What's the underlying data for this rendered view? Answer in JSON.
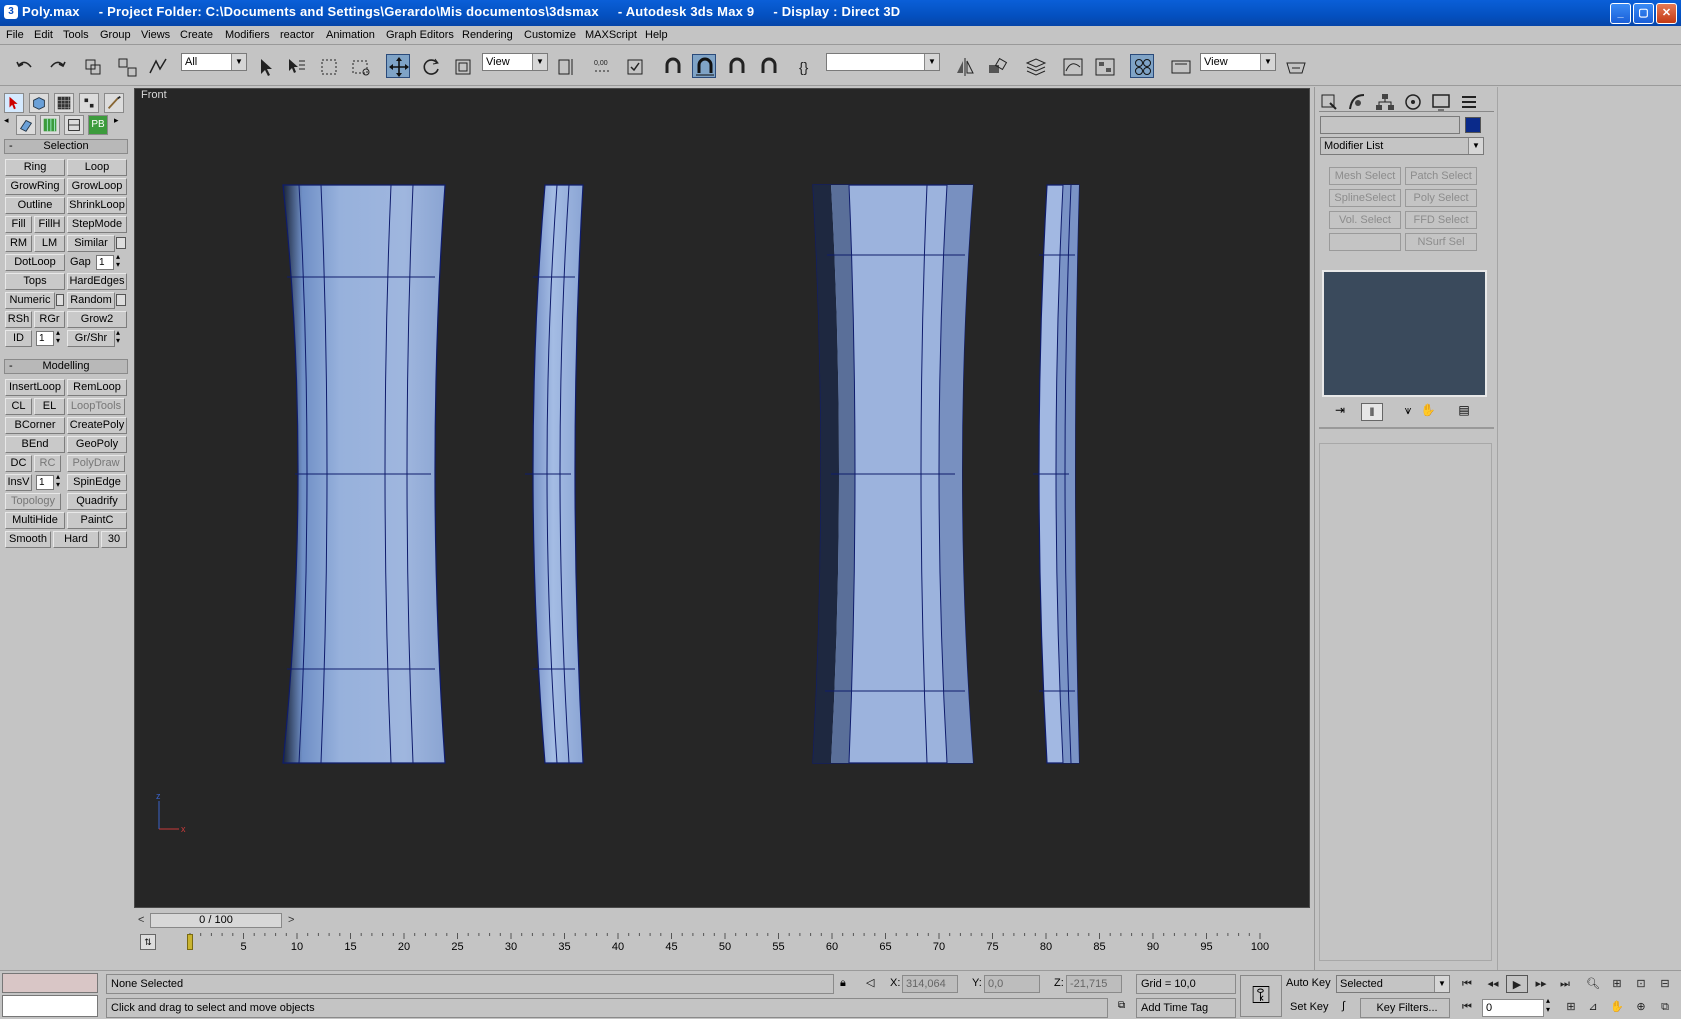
{
  "window": {
    "title": "Poly.max     - Project Folder: C:\\Documents and Settings\\Gerardo\\Mis documentos\\3dsmax     - Autodesk 3ds Max 9     - Display : Direct 3D",
    "min": "_",
    "max": "▢",
    "close": "✕"
  },
  "menu": [
    "File",
    "Edit",
    "Tools",
    "Group",
    "Views",
    "Create",
    "Modifiers",
    "reactor",
    "Animation",
    "Graph Editors",
    "Rendering",
    "Customize",
    "MAXScript",
    "Help"
  ],
  "toolbar": {
    "selection_filter": "All",
    "ref_coord": "View",
    "named_selection": "",
    "view2": "View",
    "spinner_snap": "0,00"
  },
  "leftpanel": {
    "selection_title": "Selection",
    "modelling_title": "Modelling",
    "selection_rows": [
      [
        "Ring",
        "Loop"
      ],
      [
        "GrowRing",
        "GrowLoop"
      ],
      [
        "Outline",
        "ShrinkLoop"
      ],
      [
        "Fill",
        "FillH",
        "StepMode"
      ],
      [
        "RM",
        "LM",
        "Similar"
      ],
      [
        "DotLoop",
        "Gap"
      ],
      [
        "Tops",
        "HardEdges"
      ],
      [
        "Numeric",
        "Random"
      ],
      [
        "RSh",
        "RGr",
        "Grow2"
      ],
      [
        "ID",
        "Gr/Shr"
      ]
    ],
    "gap_value": "1",
    "id_value": "1",
    "modelling_rows": [
      [
        "InsertLoop",
        "RemLoop"
      ],
      [
        "CL",
        "EL",
        "LoopTools"
      ],
      [
        "BCorner",
        "CreatePoly"
      ],
      [
        "BEnd",
        "GeoPoly"
      ],
      [
        "DC",
        "RC",
        "PolyDraw"
      ],
      [
        "InsV",
        "SpinEdge"
      ],
      [
        "Topology",
        "Quadrify"
      ],
      [
        "MultiHide",
        "PaintC"
      ],
      [
        "Smooth",
        "Hard",
        "30"
      ]
    ],
    "insv_value": "1"
  },
  "viewport": {
    "label": "Front",
    "axis_x": "x",
    "axis_z": "z"
  },
  "timeslider": {
    "position": "0 / 100",
    "ticks": [
      "5",
      "10",
      "15",
      "20",
      "25",
      "30",
      "35",
      "40",
      "45",
      "50",
      "55",
      "60",
      "65",
      "70",
      "75",
      "80",
      "85",
      "90",
      "95",
      "100"
    ]
  },
  "cmdpanel": {
    "modifier_list": "Modifier List",
    "object_color": "#0a2a8a",
    "modifier_buttons": [
      [
        "Mesh Select",
        "Patch Select"
      ],
      [
        "SplineSelect",
        "Poly Select"
      ],
      [
        "Vol. Select",
        "FFD Select"
      ],
      [
        "",
        "NSurf Sel"
      ]
    ]
  },
  "statusbar": {
    "selection": "None Selected",
    "prompt": "Click and drag to select and move objects",
    "x_label": "X:",
    "x_value": "314,064",
    "y_label": "Y:",
    "y_value": "0,0",
    "z_label": "Z:",
    "z_value": "-21,715",
    "grid": "Grid = 10,0",
    "add_time_tag": "Add Time Tag",
    "auto_key": "Auto Key",
    "set_key": "Set Key",
    "key_mode": "Selected",
    "key_filters": "Key Filters...",
    "frame": "0"
  }
}
